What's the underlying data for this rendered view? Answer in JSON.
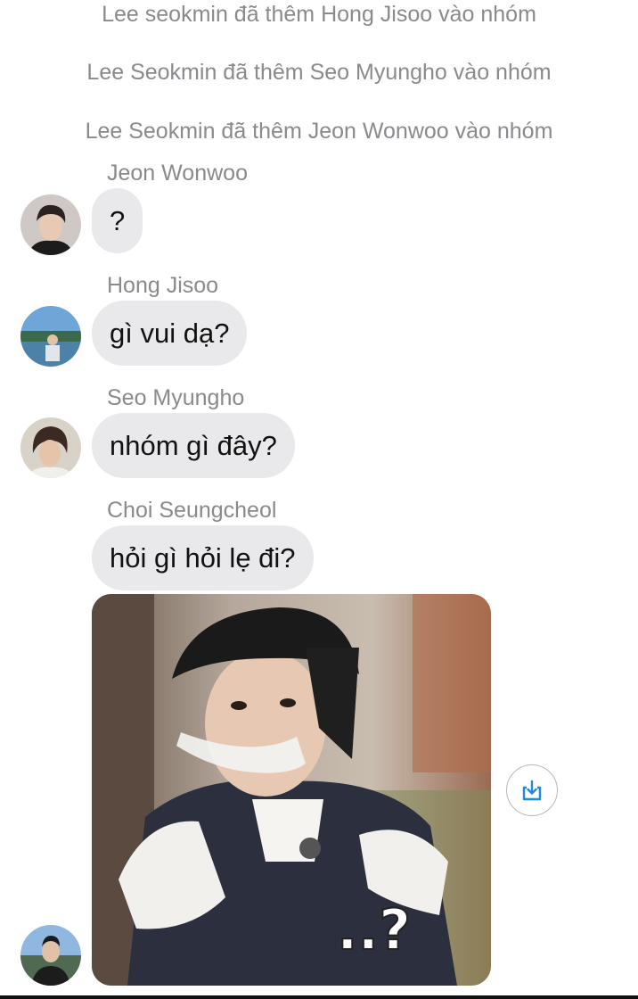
{
  "system_messages": [
    "Lee seokmin đã thêm Hong Jisoo vào nhóm",
    "Lee Seokmin đã thêm Seo Myungho vào nhóm",
    "Lee Seokmin đã thêm Jeon Wonwoo vào nhóm"
  ],
  "messages": [
    {
      "sender": "Jeon Wonwoo",
      "text": "?",
      "avatar_icon": "avatar-dark-hair"
    },
    {
      "sender": "Hong Jisoo",
      "text": "gì vui dạ?",
      "avatar_icon": "avatar-outdoor-lake"
    },
    {
      "sender": "Seo Myungho",
      "text": "nhóm gì đây?",
      "avatar_icon": "avatar-portrait"
    },
    {
      "sender": "Choi Seungcheol",
      "text": "hỏi gì hỏi lẹ đi?",
      "avatar_icon": "avatar-outdoor"
    }
  ],
  "photo": {
    "caption_overlay": "..?"
  },
  "save_button_icon": "download-icon",
  "colors": {
    "bubble": "#e9e9eb",
    "meta_text": "#8a8a8e",
    "accent": "#1e88e5"
  }
}
